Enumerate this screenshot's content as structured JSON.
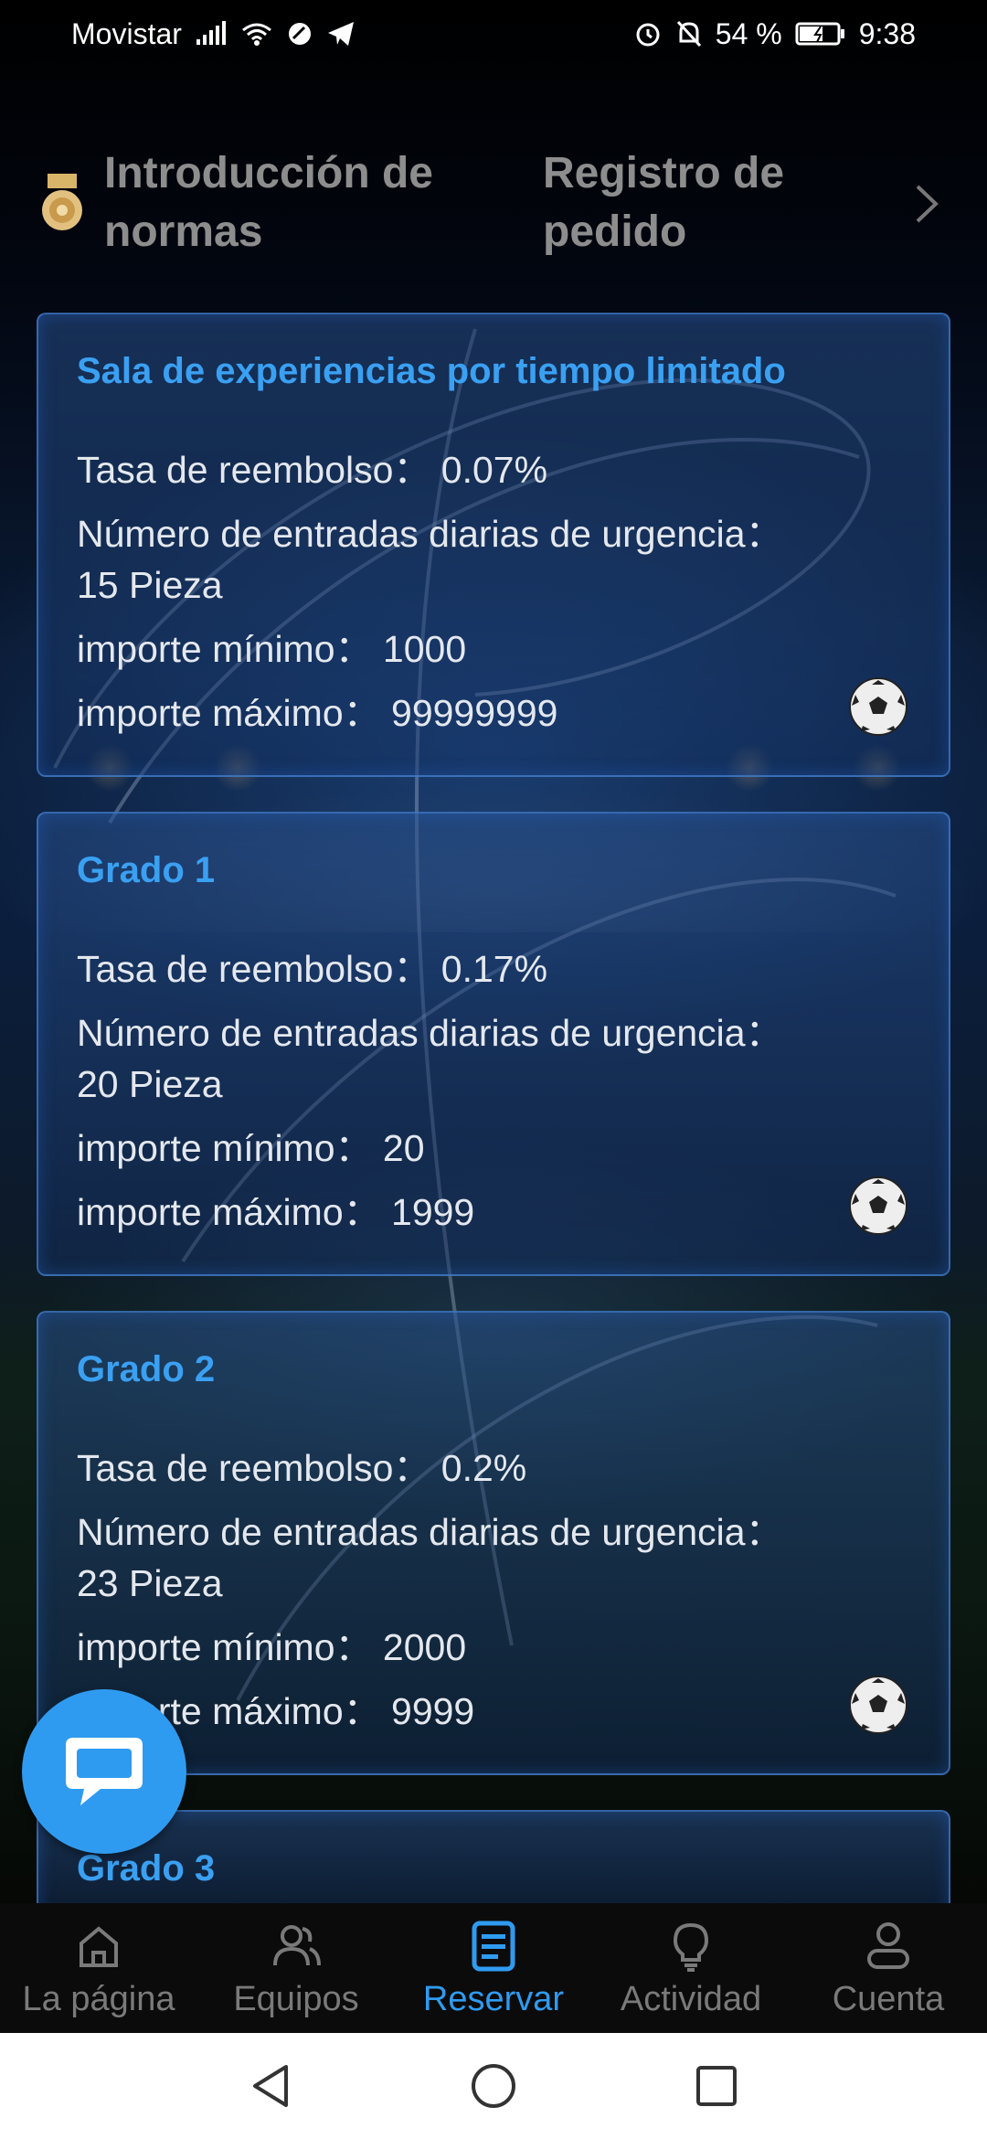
{
  "status_bar": {
    "carrier": "Movistar",
    "battery": "54 %",
    "time": "9:38"
  },
  "header": {
    "tabs": [
      {
        "label": "Introducción de normas"
      },
      {
        "label": "Registro de pedido"
      }
    ]
  },
  "cards": [
    {
      "title": "Sala de experiencias por tiempo limitado",
      "rate": "Tasa de reembolso： 0.07%",
      "entries_label": "Número de entradas diarias de urgencia：",
      "entries_value": "15 Pieza",
      "min": "importe mínimo： 1000",
      "max": "importe máximo： 99999999"
    },
    {
      "title": "Grado 1",
      "rate": "Tasa de reembolso： 0.17%",
      "entries_label": "Número de entradas diarias de urgencia：",
      "entries_value": "20 Pieza",
      "min": "importe mínimo： 20",
      "max": "importe máximo： 1999"
    },
    {
      "title": "Grado 2",
      "rate": "Tasa de reembolso： 0.2%",
      "entries_label": "Número de entradas diarias de urgencia：",
      "entries_value": "23 Pieza",
      "min": "importe mínimo： 2000",
      "max": "importe máximo： 9999"
    },
    {
      "title": "Grado 3"
    }
  ],
  "bottom_nav": [
    {
      "label": "La página",
      "icon": "home-icon"
    },
    {
      "label": "Equipos",
      "icon": "team-icon"
    },
    {
      "label": "Reservar",
      "icon": "reserve-icon",
      "active": true
    },
    {
      "label": "Actividad",
      "icon": "lightbulb-icon"
    },
    {
      "label": "Cuenta",
      "icon": "account-icon"
    }
  ],
  "colors": {
    "accent": "#2f9bf0",
    "card_title": "#3aa0f2",
    "header_tab": "#8d8d8d",
    "nav_inactive": "#7a7a7a"
  }
}
